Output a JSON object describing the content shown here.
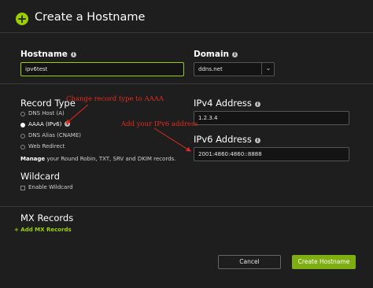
{
  "dialog": {
    "title": "Create a Hostname"
  },
  "hostname": {
    "label": "Hostname",
    "value": "ipv6test"
  },
  "domain": {
    "label": "Domain",
    "value": "ddns.net"
  },
  "record_type": {
    "label": "Record Type",
    "options": [
      {
        "label": "DNS Host (A)",
        "selected": false
      },
      {
        "label": "AAAA (IPv6)",
        "selected": true
      },
      {
        "label": "DNS Alias (CNAME)",
        "selected": false
      },
      {
        "label": "Web Redirect",
        "selected": false
      }
    ],
    "manage_link": "Manage",
    "manage_text": "your Round Robin, TXT, SRV and DKIM records."
  },
  "ipv4": {
    "label": "IPv4 Address",
    "value": "1.2.3.4"
  },
  "ipv6": {
    "label": "IPv6 Address",
    "value": "2001:4860:4860::8888"
  },
  "wildcard": {
    "label": "Wildcard",
    "checkbox_label": "Enable Wildcard"
  },
  "mx": {
    "label": "MX Records",
    "add_label": "+ Add MX Records"
  },
  "annotations": {
    "record_type_note": "Change record type to AAAA",
    "ipv6_note": "Add your IPv6 address"
  },
  "buttons": {
    "cancel": "Cancel",
    "create": "Create Hostname"
  },
  "colors": {
    "accent": "#9bd000",
    "annotation": "#e62a1e",
    "primary_button": "#7fae13"
  }
}
